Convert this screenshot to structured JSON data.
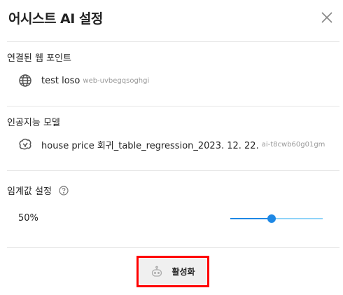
{
  "header": {
    "title": "어시스트 AI 설정",
    "close_icon": "close-icon"
  },
  "endpoint": {
    "label": "연결된 웹 포인트",
    "name": "test loso",
    "id": "web-uvbegqsoghgi",
    "icon": "globe-icon"
  },
  "model": {
    "label": "인공지능 모델",
    "name": "house price 회귀_table_regression_2023. 12. 22.",
    "id": "ai-t8cwb60g01gm",
    "icon": "brain-icon"
  },
  "threshold": {
    "label": "임계값 설정",
    "help_icon": "help-circle-icon",
    "value_label": "50%",
    "slider_fraction": 0.45,
    "accent": "#1e88e5",
    "track_color": "#90d4f9"
  },
  "footer": {
    "activate_label": "활성화",
    "icon": "robot-icon",
    "highlight": "#ff0000"
  }
}
